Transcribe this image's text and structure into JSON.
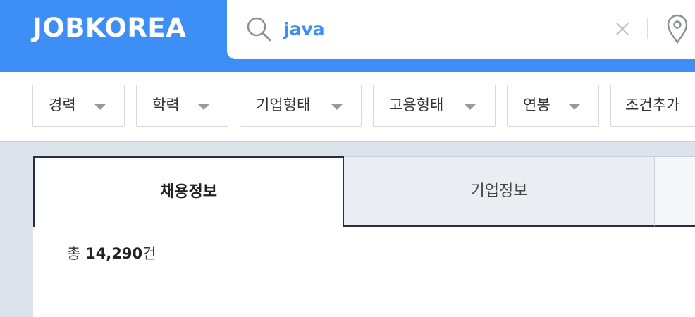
{
  "header": {
    "logo": "JOBKOREA",
    "search_value": "java",
    "search_icon": "search-icon",
    "clear_icon": "close-icon",
    "location_icon": "location-pin-icon",
    "brand_color": "#3d8ef5"
  },
  "filters": [
    {
      "label": "경력"
    },
    {
      "label": "학력"
    },
    {
      "label": "기업형태"
    },
    {
      "label": "고용형태"
    },
    {
      "label": "연봉"
    },
    {
      "label": "조건추가"
    }
  ],
  "tabs": [
    {
      "label": "채용정보",
      "active": true
    },
    {
      "label": "기업정보",
      "active": false
    }
  ],
  "results": {
    "prefix": "총",
    "count": "14,290",
    "suffix": "건"
  }
}
